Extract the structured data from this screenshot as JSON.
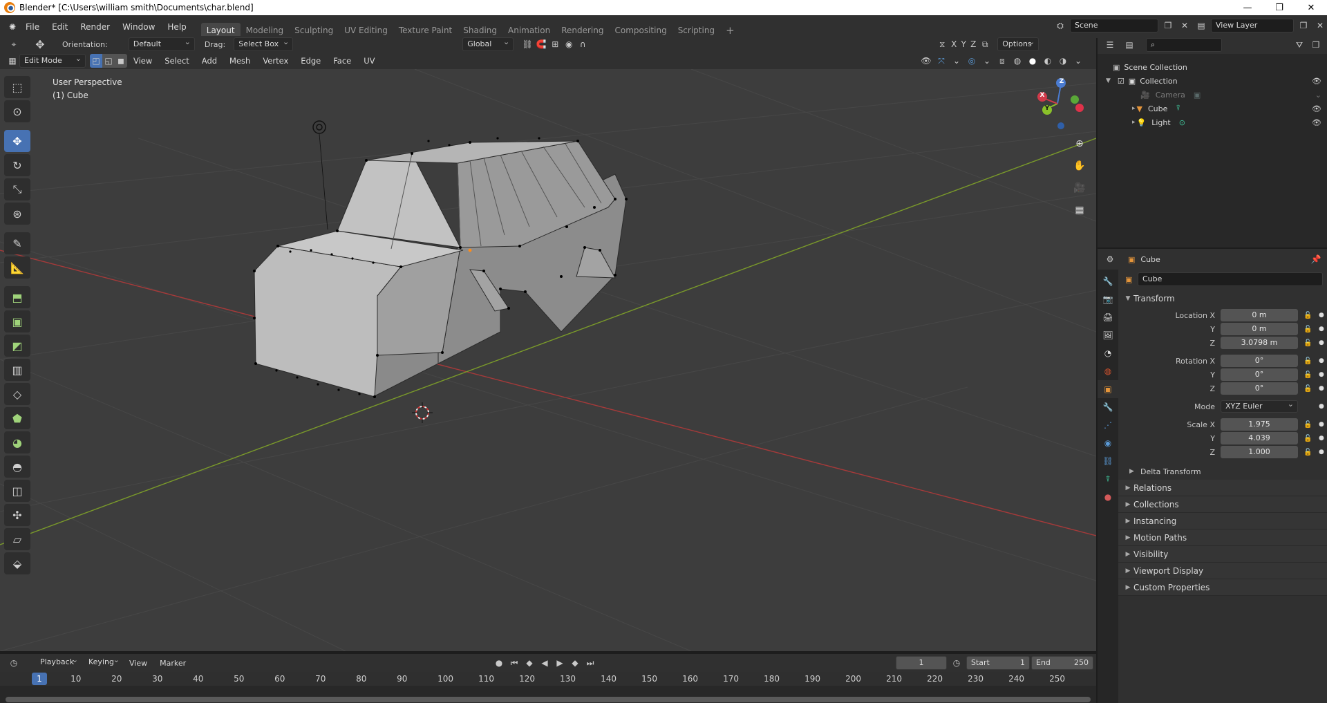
{
  "window": {
    "title": "Blender* [C:\\Users\\william smith\\Documents\\char.blend]",
    "controls": [
      "—",
      "❐",
      "✕"
    ]
  },
  "menu": [
    "File",
    "Edit",
    "Render",
    "Window",
    "Help"
  ],
  "workspaces": [
    "Layout",
    "Modeling",
    "Sculpting",
    "UV Editing",
    "Texture Paint",
    "Shading",
    "Animation",
    "Rendering",
    "Compositing",
    "Scripting"
  ],
  "active_workspace": "Layout",
  "scene": {
    "name": "Scene",
    "view_layer": "View Layer"
  },
  "tool_header": {
    "orientation_label": "Orientation:",
    "orientation_value": "Default",
    "drag_label": "Drag:",
    "drag_value": "Select Box",
    "transform_orientation": "Global",
    "options_label": "Options",
    "axes": [
      "X",
      "Y",
      "Z"
    ]
  },
  "viewport_header": {
    "mode": "Edit Mode",
    "menus": [
      "View",
      "Select",
      "Add",
      "Mesh",
      "Vertex",
      "Edge",
      "Face",
      "UV"
    ]
  },
  "viewport": {
    "perspective_label": "User Perspective",
    "object_label": "(1) Cube",
    "gizmo": {
      "z": "Z",
      "y": "Y",
      "x": "X"
    },
    "colors": {
      "background": "#3d3d3d",
      "x_axis": "#a63a3a",
      "y_axis": "#7a9a2a",
      "mesh_face": "#bdbdbd",
      "mesh_dark": "#8f8f8f"
    }
  },
  "tools": [
    "select-box-icon",
    "cursor-icon",
    "move-icon",
    "rotate-icon",
    "scale-icon",
    "transform-icon",
    "annotate-icon",
    "measure-icon",
    "extrude-icon",
    "inset-icon",
    "bevel-icon",
    "loop-cut-icon",
    "knife-icon",
    "poly-build-icon",
    "spin-icon",
    "smooth-icon",
    "edge-slide-icon",
    "shrink-icon",
    "shear-icon",
    "rip-icon"
  ],
  "active_tool": "move-icon",
  "outliner": {
    "root": "Scene Collection",
    "collection": "Collection",
    "items": [
      {
        "name": "Camera",
        "dim": true
      },
      {
        "name": "Cube",
        "dim": false
      },
      {
        "name": "Light",
        "dim": false
      }
    ]
  },
  "properties": {
    "object_name_header": "Cube",
    "object_name_field": "Cube",
    "transform_title": "Transform",
    "location": {
      "label": "Location X",
      "x": "0 m",
      "y": "0 m",
      "z": "3.0798 m"
    },
    "rotation": {
      "label": "Rotation X",
      "x": "0°",
      "y": "0°",
      "z": "0°"
    },
    "mode_label": "Mode",
    "mode_value": "XYZ Euler",
    "scale": {
      "label": "Scale X",
      "x": "1.975",
      "y": "4.039",
      "z": "1.000"
    },
    "axis_labels": {
      "y": "Y",
      "z": "Z"
    },
    "delta_transform": "Delta Transform",
    "sections": [
      "Relations",
      "Collections",
      "Instancing",
      "Motion Paths",
      "Visibility",
      "Viewport Display",
      "Custom Properties"
    ]
  },
  "timeline": {
    "menus": [
      "Playback",
      "Keying",
      "View",
      "Marker"
    ],
    "current_frame": "1",
    "start_label": "Start",
    "start": "1",
    "end_label": "End",
    "end": "250",
    "ruler": [
      "1",
      "10",
      "20",
      "30",
      "40",
      "50",
      "60",
      "70",
      "80",
      "90",
      "100",
      "110",
      "120",
      "130",
      "140",
      "150",
      "160",
      "170",
      "180",
      "190",
      "200",
      "210",
      "220",
      "230",
      "240",
      "250"
    ]
  }
}
